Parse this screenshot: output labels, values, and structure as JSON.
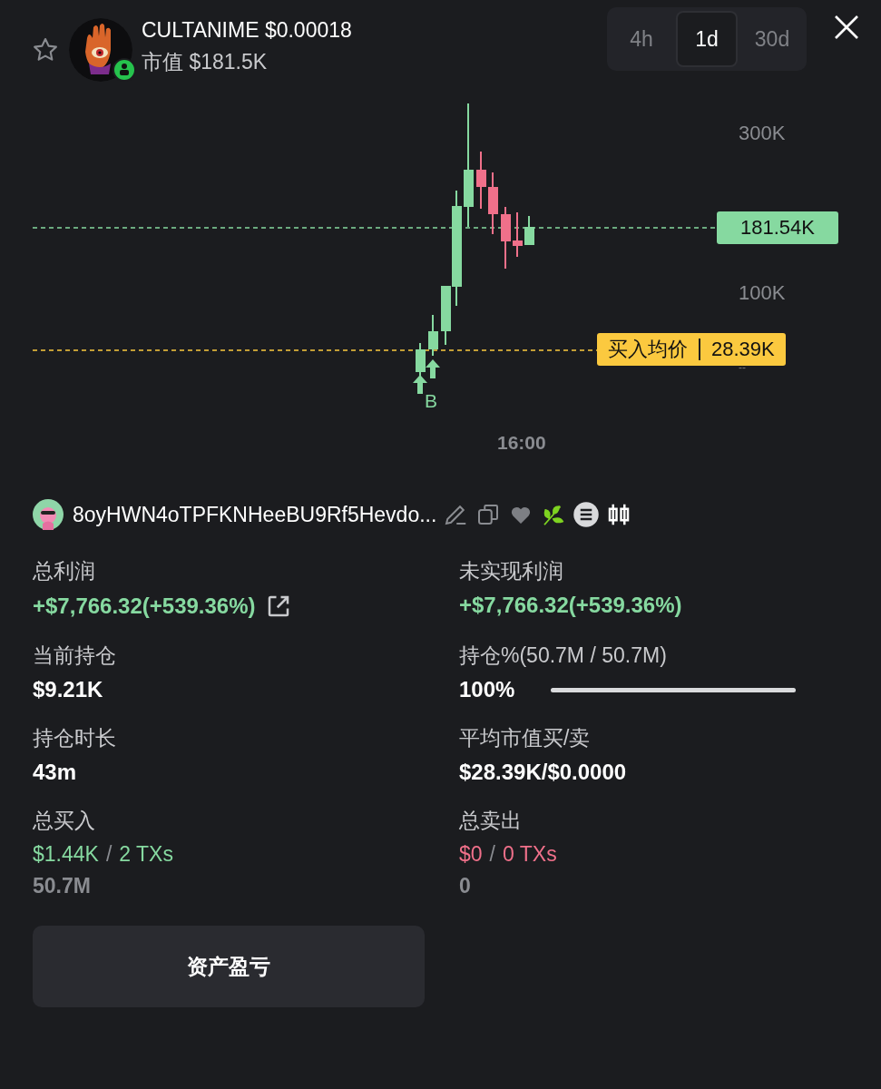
{
  "token": {
    "name": "CULTANIME $0.00018",
    "market_cap": "市值 $181.5K"
  },
  "timeframes": [
    {
      "label": "4h",
      "selected": false
    },
    {
      "label": "1d",
      "selected": true
    },
    {
      "label": "30d",
      "selected": false
    }
  ],
  "chart": {
    "y_labels": [
      {
        "text": "300K",
        "kind": "tick"
      },
      {
        "text": "100K",
        "kind": "tick"
      }
    ],
    "price_tag": "181.54K",
    "avg_label": "买入均价",
    "avg_value": "28.39K",
    "avg_sub": "--",
    "buy_marker": "B",
    "time_label": "16:00"
  },
  "wallet": {
    "address": "8oyHWN4oTPFKNHeeBU9Rf5Hevdo..."
  },
  "stats": [
    {
      "kind": "value_link",
      "label": "总利润",
      "value": "+$7,766.32(+539.36%)",
      "color": "#86d9a0"
    },
    {
      "kind": "value",
      "label": "未实现利润",
      "value": "+$7,766.32(+539.36%)",
      "color": "#86d9a0"
    },
    {
      "kind": "value",
      "label": "当前持仓",
      "value": "$9.21K"
    },
    {
      "kind": "meter",
      "label": "持仓%(50.7M / 50.7M)",
      "value": "100%",
      "level": 1
    },
    {
      "kind": "value",
      "label": "持仓时长",
      "value": "43m"
    },
    {
      "kind": "value",
      "label": "平均市值买/卖",
      "value": "$28.39K/$0.0000"
    },
    {
      "kind": "trades",
      "label": "总买入",
      "amount": "$1.44K",
      "divider": "/",
      "txs": "2 TXs",
      "sub": "50.7M",
      "color": "#86d9a0"
    },
    {
      "kind": "trades",
      "label": "总卖出",
      "amount": "$0",
      "divider": "/",
      "txs": "0 TXs",
      "sub": "0",
      "color": "#f0708a"
    }
  ],
  "button": "资产盈亏"
}
